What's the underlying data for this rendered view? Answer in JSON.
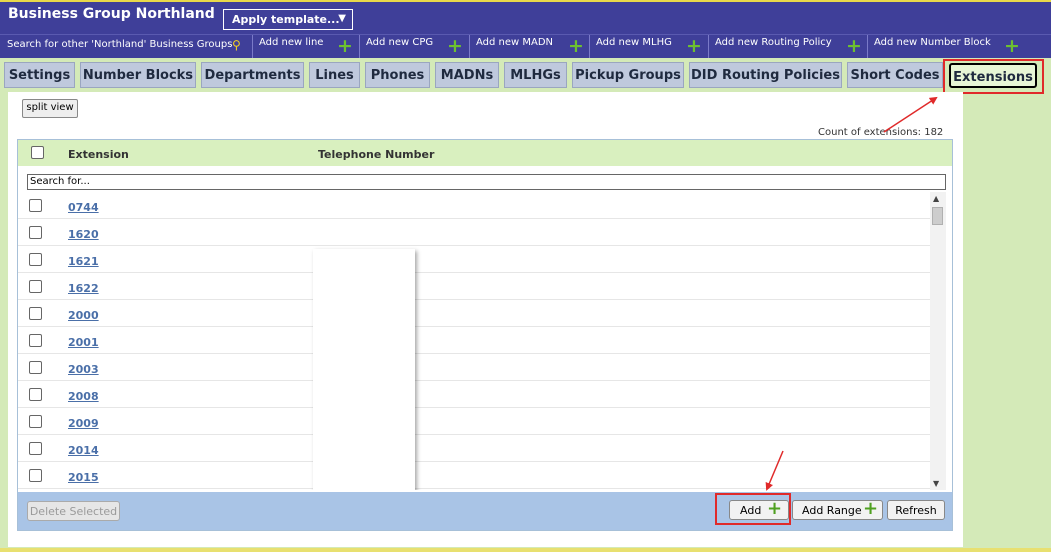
{
  "header": {
    "title": "Business Group Northland",
    "template_label": "Apply template...",
    "template_arrow_icon": "chevron-down-icon"
  },
  "action_bar": {
    "search_label": "Search for other 'Northland' Business Groups",
    "search_icon": "magnifier-icon",
    "add_icon": "plus-icon",
    "items": [
      {
        "label": "Add new line"
      },
      {
        "label": "Add new CPG"
      },
      {
        "label": "Add new MADN"
      },
      {
        "label": "Add new MLHG"
      },
      {
        "label": "Add new Routing Policy"
      },
      {
        "label": "Add new Number Block"
      }
    ]
  },
  "tabs": [
    {
      "label": "Settings"
    },
    {
      "label": "Number Blocks"
    },
    {
      "label": "Departments"
    },
    {
      "label": "Lines"
    },
    {
      "label": "Phones"
    },
    {
      "label": "MADNs"
    },
    {
      "label": "MLHGs"
    },
    {
      "label": "Pickup Groups"
    },
    {
      "label": "DID Routing Policies"
    },
    {
      "label": "Short Codes"
    },
    {
      "label": "Extensions",
      "active": true
    }
  ],
  "toolbar": {
    "split_view_label": "split view",
    "count_label": "Count of extensions: 182"
  },
  "grid": {
    "columns": [
      "Extension",
      "Telephone Number"
    ],
    "search_placeholder": "Search for...",
    "rows": [
      {
        "extension": "0744"
      },
      {
        "extension": "1620"
      },
      {
        "extension": "1621"
      },
      {
        "extension": "1622"
      },
      {
        "extension": "2000"
      },
      {
        "extension": "2001"
      },
      {
        "extension": "2003"
      },
      {
        "extension": "2008"
      },
      {
        "extension": "2009"
      },
      {
        "extension": "2014"
      },
      {
        "extension": "2015"
      }
    ]
  },
  "footer": {
    "delete_label": "Delete Selected",
    "add_label": "Add",
    "add_range_label": "Add Range",
    "refresh_label": "Refresh"
  },
  "colors": {
    "header_bg": "#3f3f99",
    "page_bg": "#d4eab8",
    "tab_bg": "#bfc9dd",
    "grid_header_bg": "#d9f0bf",
    "footer_bg": "#a9c4e6",
    "link": "#4a6fa8",
    "annotation": "#e02a2a",
    "plus": "#6cc030"
  }
}
